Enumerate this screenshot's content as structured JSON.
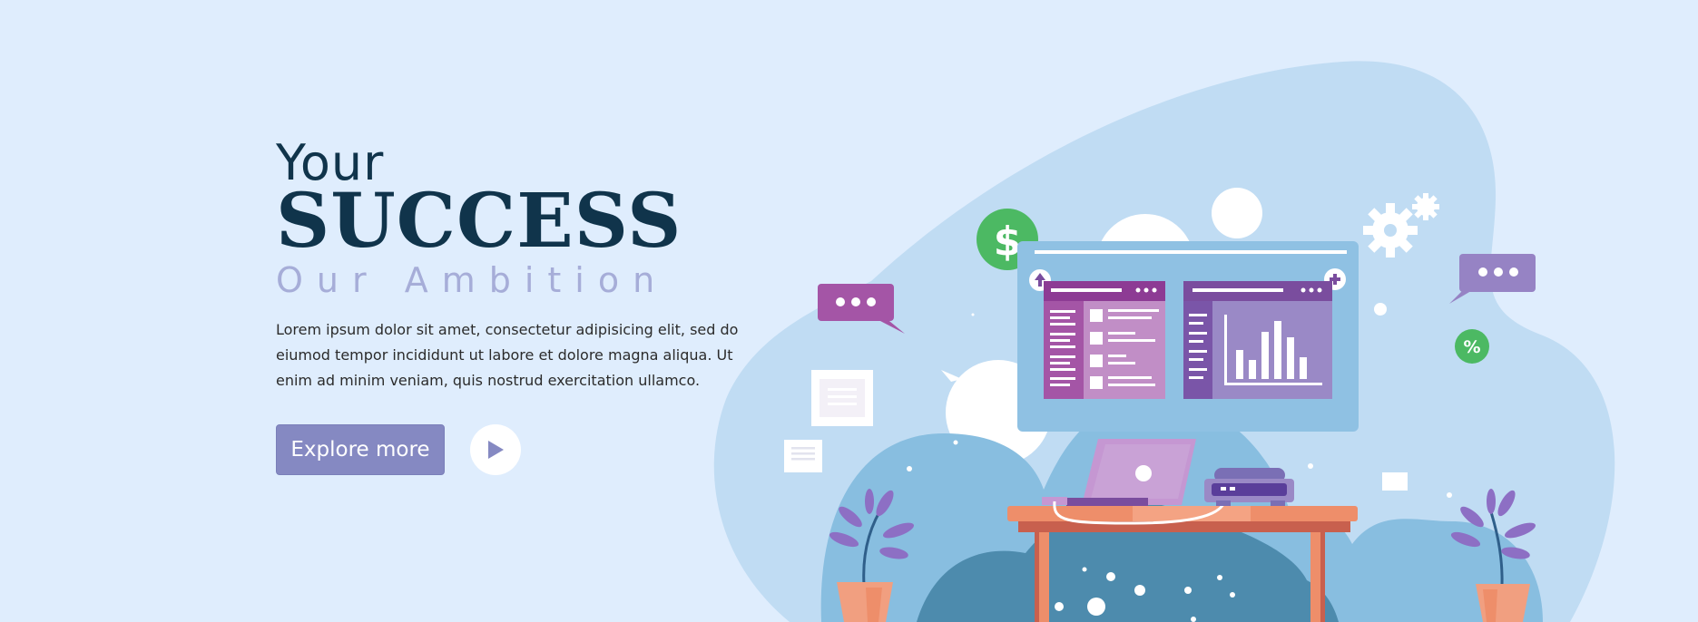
{
  "hero": {
    "title_line1": "Your",
    "title_line2": "SUCCESS",
    "title_line3": "Our Ambition",
    "lead": "Lorem ipsum dolor sit amet, consectetur adipisicing elit, sed do eiumod tempor incididunt ut labore et dolore magna aliqua. Ut enim ad minim veniam, quis nostrud exercitation ullamco.",
    "explore_label": "Explore more",
    "play_icon": "play-icon"
  },
  "illustration": {
    "currency_symbol": "$",
    "percent_symbol": "%",
    "icons": [
      "dollar-icon",
      "percent-icon",
      "gear-icon",
      "chat-bubble-icon",
      "laptop-icon",
      "plant-icon",
      "bar-chart-icon"
    ]
  },
  "colors": {
    "background": "#dfedfd",
    "heading": "#10344b",
    "subheading": "#a6add8",
    "button": "#8589c2",
    "accent_green": "#4cb963",
    "accent_purple": "#7a4d9e"
  }
}
